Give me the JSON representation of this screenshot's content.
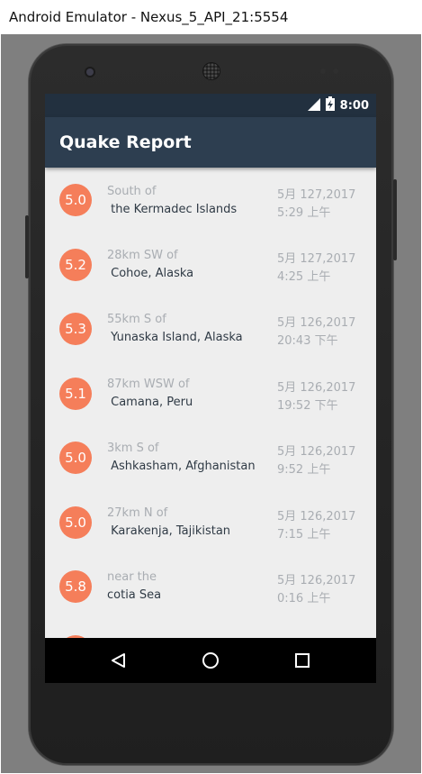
{
  "window": {
    "title": "Android Emulator - Nexus_5_API_21:5554"
  },
  "status_bar": {
    "time": "8:00"
  },
  "app_bar": {
    "title": "Quake Report"
  },
  "colors": {
    "app_bar": "#2d3e50",
    "status_bar": "#22303f",
    "magnitude_circle": "#f57e5a",
    "list_background": "#eeeeee"
  },
  "earthquakes": [
    {
      "magnitude": "5.0",
      "offset": "South of",
      "primary": " the Kermadec Islands",
      "date": "5月 127,2017",
      "time": "5:29 上午"
    },
    {
      "magnitude": "5.2",
      "offset": "28km SW of",
      "primary": " Cohoe, Alaska",
      "date": "5月 127,2017",
      "time": "4:25 上午"
    },
    {
      "magnitude": "5.3",
      "offset": "55km S of",
      "primary": " Yunaska Island, Alaska",
      "date": "5月 126,2017",
      "time": "20:43 下午"
    },
    {
      "magnitude": "5.1",
      "offset": "87km WSW of",
      "primary": " Camana, Peru",
      "date": "5月 126,2017",
      "time": "19:52 下午"
    },
    {
      "magnitude": "5.0",
      "offset": "3km S of",
      "primary": " Ashkasham, Afghanistan",
      "date": "5月 126,2017",
      "time": "9:52 上午"
    },
    {
      "magnitude": "5.0",
      "offset": "27km N of",
      "primary": " Karakenja, Tajikistan",
      "date": "5月 126,2017",
      "time": "7:15 上午"
    },
    {
      "magnitude": "5.8",
      "offset": "near the",
      "primary": "cotia Sea",
      "date": "5月 126,2017",
      "time": "0:16 上午"
    }
  ],
  "nav_bar": {
    "back": "back-icon",
    "home": "home-icon",
    "recents": "recents-icon"
  }
}
